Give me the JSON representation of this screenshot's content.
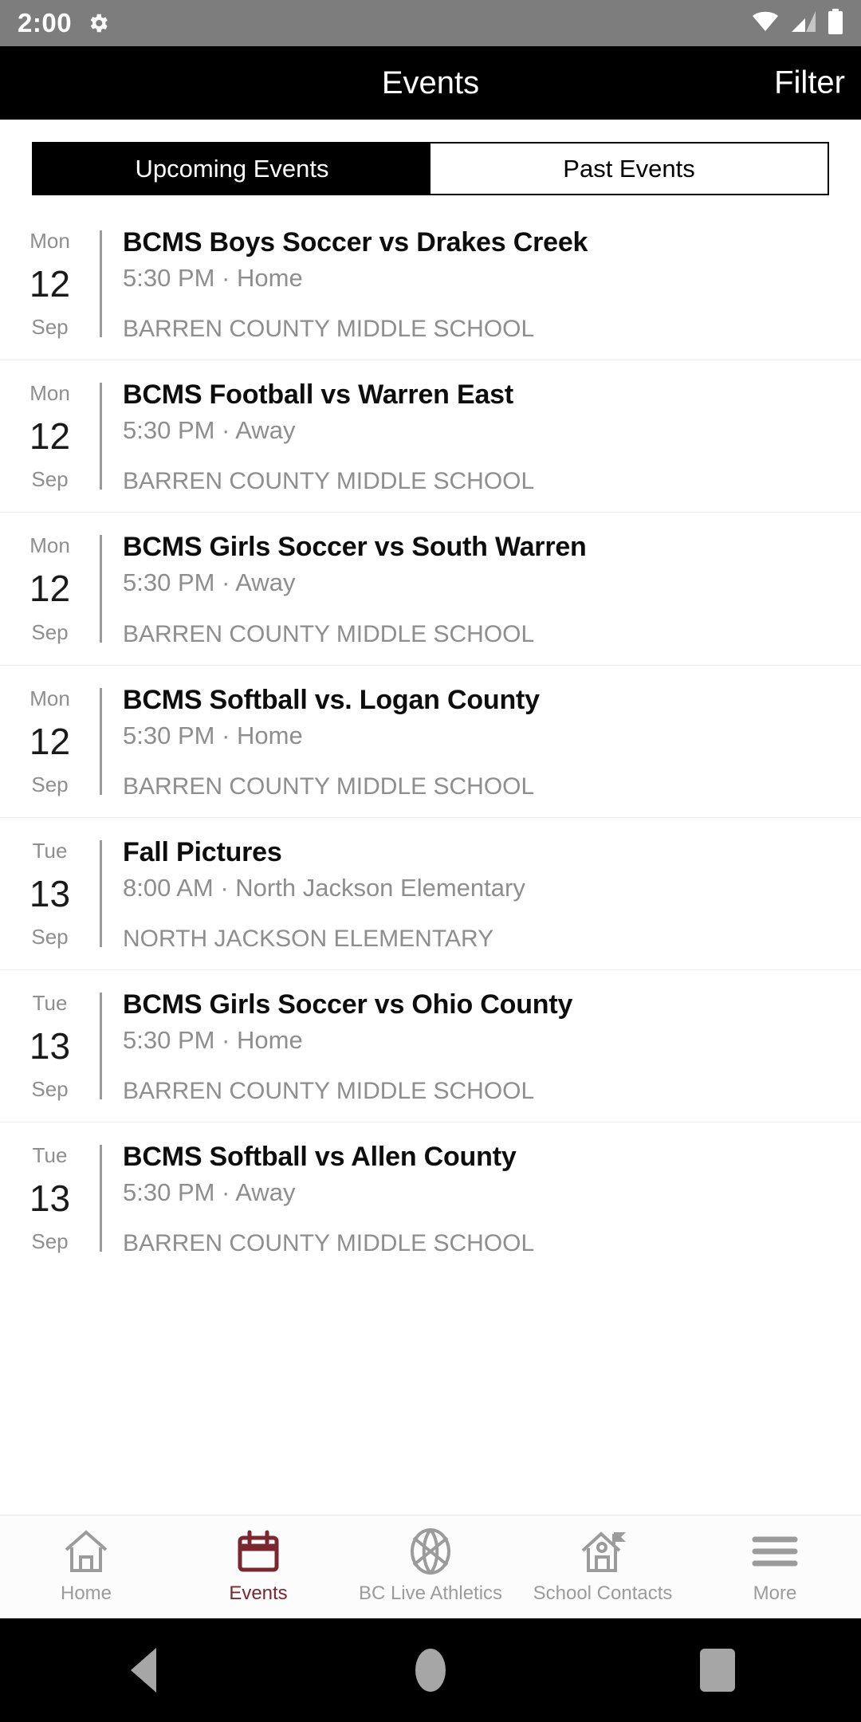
{
  "status_bar": {
    "time": "2:00",
    "icons": [
      "gear-icon",
      "wifi-icon",
      "cellular-signal-icon",
      "battery-icon"
    ]
  },
  "app_bar": {
    "title": "Events",
    "action_label": "Filter"
  },
  "tabs": [
    {
      "label": "Upcoming Events",
      "active": true
    },
    {
      "label": "Past Events",
      "active": false
    }
  ],
  "events": [
    {
      "dow": "Mon",
      "day": "12",
      "month": "Sep",
      "title": "BCMS Boys Soccer vs Drakes Creek",
      "subtitle": "5:30 PM · Home",
      "location": "BARREN COUNTY MIDDLE SCHOOL"
    },
    {
      "dow": "Mon",
      "day": "12",
      "month": "Sep",
      "title": "BCMS Football vs Warren East",
      "subtitle": "5:30 PM · Away",
      "location": "BARREN COUNTY MIDDLE SCHOOL"
    },
    {
      "dow": "Mon",
      "day": "12",
      "month": "Sep",
      "title": "BCMS Girls Soccer vs South Warren",
      "subtitle": "5:30 PM · Away",
      "location": "BARREN COUNTY MIDDLE SCHOOL"
    },
    {
      "dow": "Mon",
      "day": "12",
      "month": "Sep",
      "title": "BCMS Softball vs. Logan County",
      "subtitle": "5:30 PM · Home",
      "location": "BARREN COUNTY MIDDLE SCHOOL"
    },
    {
      "dow": "Tue",
      "day": "13",
      "month": "Sep",
      "title": "Fall Pictures",
      "subtitle": "8:00 AM · North Jackson Elementary",
      "location": "NORTH JACKSON ELEMENTARY"
    },
    {
      "dow": "Tue",
      "day": "13",
      "month": "Sep",
      "title": "BCMS Girls Soccer vs Ohio County",
      "subtitle": "5:30 PM · Home",
      "location": "BARREN COUNTY MIDDLE SCHOOL"
    },
    {
      "dow": "Tue",
      "day": "13",
      "month": "Sep",
      "title": "BCMS Softball vs Allen County",
      "subtitle": "5:30 PM · Away",
      "location": "BARREN COUNTY MIDDLE SCHOOL"
    }
  ],
  "bottom_nav": [
    {
      "label": "Home",
      "icon": "home-icon",
      "active": false
    },
    {
      "label": "Events",
      "icon": "calendar-icon",
      "active": true
    },
    {
      "label": "BC Live Athletics",
      "icon": "basketball-icon",
      "active": false
    },
    {
      "label": "School Contacts",
      "icon": "school-building-icon",
      "active": false
    },
    {
      "label": "More",
      "icon": "hamburger-menu-icon",
      "active": false
    }
  ],
  "android_nav": {
    "back": "back-triangle-icon",
    "home": "home-circle-icon",
    "recents": "recents-square-icon"
  },
  "colors": {
    "accent": "#7a2730",
    "app_bar_bg": "#000000",
    "status_bar_bg": "#7d7d7d",
    "muted_text": "#8e8e8e"
  }
}
